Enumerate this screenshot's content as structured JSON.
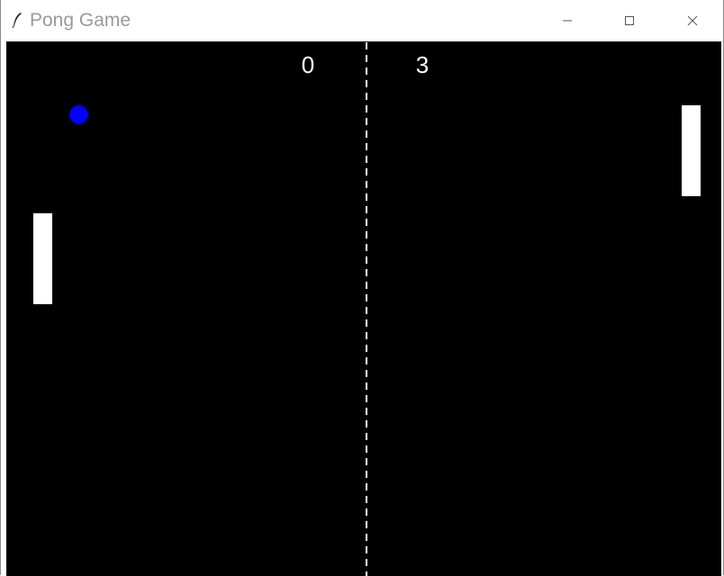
{
  "window": {
    "title": "Pong Game",
    "icon": "feather-icon"
  },
  "controls": {
    "minimize_icon": "minimize-icon",
    "maximize_icon": "maximize-icon",
    "close_icon": "close-icon"
  },
  "game": {
    "score_left": "0",
    "score_right": "3",
    "background_color": "#000000",
    "ball_color": "#0000ff",
    "paddle_color": "#ffffff"
  }
}
